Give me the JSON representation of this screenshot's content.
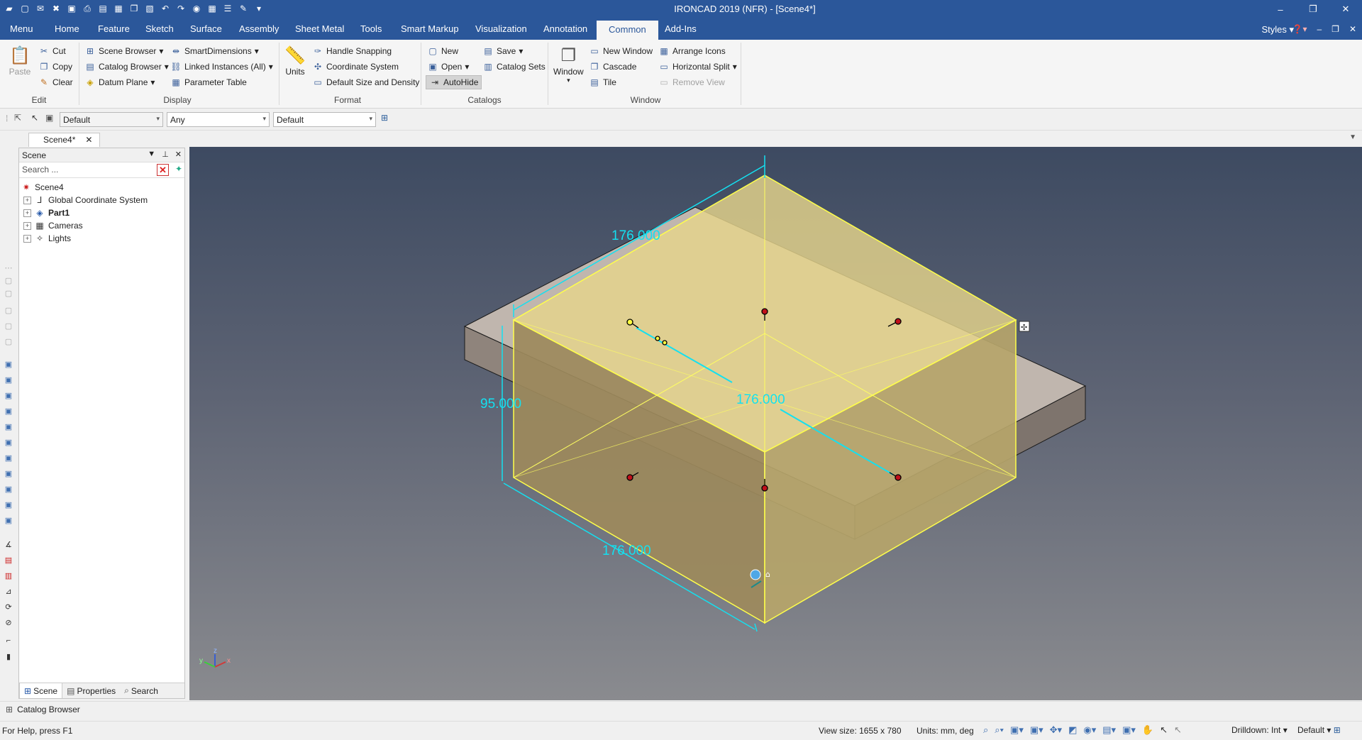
{
  "window": {
    "title": "IRONCAD 2019 (NFR) - [Scene4*]",
    "controls": [
      "–",
      "❐",
      "✕"
    ]
  },
  "quick_access_icons": [
    "new-icon",
    "open-icon",
    "close-icon",
    "save-icon",
    "print-icon",
    "folder-icon",
    "save-as-icon",
    "undo-icon",
    "redo-icon",
    "globe-icon",
    "grid-icon",
    "menu-icon"
  ],
  "ribbon_tabs": [
    "Menu",
    "Home",
    "Feature",
    "Sketch",
    "Surface",
    "Assembly",
    "Sheet Metal",
    "Tools",
    "Smart Markup",
    "Visualization",
    "Annotation",
    "Common",
    "Add-Ins"
  ],
  "active_tab": "Common",
  "styles_label": "Styles",
  "ribbon": {
    "edit": {
      "paste": "Paste",
      "cut": "Cut",
      "copy": "Copy",
      "clear": "Clear",
      "group": "Edit"
    },
    "display": {
      "scene_browser": "Scene Browser",
      "catalog_browser": "Catalog Browser",
      "datum_plane": "Datum Plane",
      "smart_dimensions": "SmartDimensions",
      "linked_instances": "Linked Instances (All)",
      "parameter_table": "Parameter Table",
      "group": "Display"
    },
    "format": {
      "units": "Units",
      "handle_snapping": "Handle Snapping",
      "coordinate_system": "Coordinate System",
      "default_size": "Default Size and Density",
      "group": "Format"
    },
    "catalogs": {
      "new": "New",
      "open": "Open",
      "autohide": "AutoHide",
      "save": "Save",
      "catalog_sets": "Catalog Sets",
      "group": "Catalogs"
    },
    "window": {
      "window": "Window",
      "new_window": "New Window",
      "cascade": "Cascade",
      "tile": "Tile",
      "arrange_icons": "Arrange Icons",
      "horizontal_split": "Horizontal Split",
      "remove_view": "Remove View",
      "group": "Window"
    }
  },
  "toolbar2": {
    "combo1": "Default",
    "combo2": "Any",
    "combo3": "Default"
  },
  "doc_tab": {
    "label": "Scene4*",
    "close": "✕"
  },
  "scene_panel": {
    "title": "Scene",
    "search_placeholder": "Search ...",
    "tree": [
      {
        "label": "Scene4",
        "icon": "scene-icon"
      },
      {
        "label": "Global Coordinate System",
        "icon": "axes-icon"
      },
      {
        "label": "Part1",
        "icon": "part-icon"
      },
      {
        "label": "Cameras",
        "icon": "camera-icon"
      },
      {
        "label": "Lights",
        "icon": "light-icon"
      }
    ],
    "bottom_tabs": [
      "Scene",
      "Properties",
      "Search"
    ]
  },
  "viewport": {
    "dim_top": "176.000",
    "dim_middle": "176.000",
    "dim_bottom": "176.000",
    "dim_height": "95.000",
    "axis_labels": {
      "x": "x",
      "y": "y",
      "z": "z"
    },
    "colors": {
      "box_fill": "#e5d48b",
      "box_edge": "#ffff4a",
      "dimension": "#14e0f0",
      "plate": "#938a84",
      "handle": "#c0101a"
    }
  },
  "catalog_bar": {
    "label": "Catalog Browser"
  },
  "status": {
    "help": "For Help, press F1",
    "view_size": "View size: 1655 x  780",
    "units": "Units: mm, deg",
    "drilldown": "Drilldown: Int",
    "default": "Default"
  }
}
